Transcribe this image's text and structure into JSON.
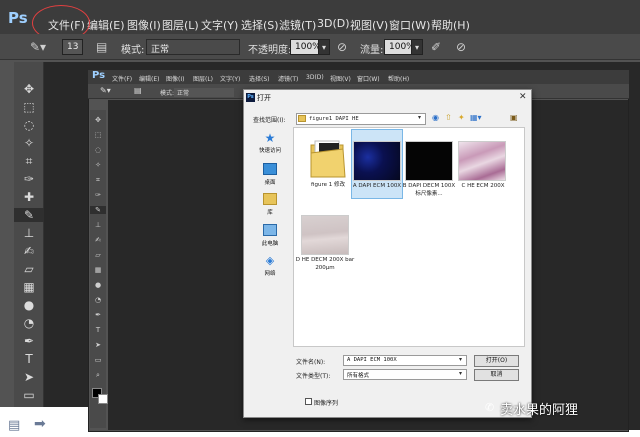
{
  "outer": {
    "app_logo": "Ps",
    "menu": [
      "文件(F)",
      "编辑(E)",
      "图像(I)",
      "图层(L)",
      "文字(Y)",
      "选择(S)",
      "滤镜(T)",
      "3D(D)",
      "视图(V)",
      "窗口(W)",
      "帮助(H)"
    ],
    "options": {
      "mode_label": "模式:",
      "mode_value": "正常",
      "opacity_label": "不透明度:",
      "opacity_value": "100%",
      "flow_label": "流量:",
      "flow_value": "100%",
      "brush_size": "13"
    },
    "highlight_color": "#e04040"
  },
  "inner": {
    "app_logo": "Ps",
    "menu": [
      "文件(F)",
      "编辑(E)",
      "图像(I)",
      "图层(L)",
      "文字(Y)",
      "选择(S)",
      "滤镜(T)",
      "3D(D)",
      "视图(V)",
      "窗口(W)",
      "帮助(H)"
    ],
    "options": {
      "mode_label": "模式:",
      "mode_value": "正常"
    }
  },
  "dialog": {
    "title": "打开",
    "look_in_label": "查找范围(I):",
    "look_in_value": "figure1 DAPI HE",
    "places": [
      "快速访问",
      "桌面",
      "库",
      "此电脑",
      "网络"
    ],
    "files": [
      {
        "name": "figure 1 修改",
        "kind": "folder"
      },
      {
        "name": "A DAPI ECM 100X",
        "kind": "image-dapi",
        "selected": true
      },
      {
        "name": "B DAPI DECM 100X 标尺像素...",
        "kind": "image-dark"
      },
      {
        "name": "C HE ECM 200X",
        "kind": "image-he"
      },
      {
        "name": "D HE DECM 200X bar 200μm",
        "kind": "image-he-light"
      }
    ],
    "filename_label": "文件名(N):",
    "filename_value": "A DAPI ECM 100X",
    "filetype_label": "文件类型(T):",
    "filetype_value": "所有格式",
    "open_button": "打开(O)",
    "cancel_button": "取消",
    "image_sequence_label": "图像序列"
  },
  "watermark": "卖水果的阿狸"
}
